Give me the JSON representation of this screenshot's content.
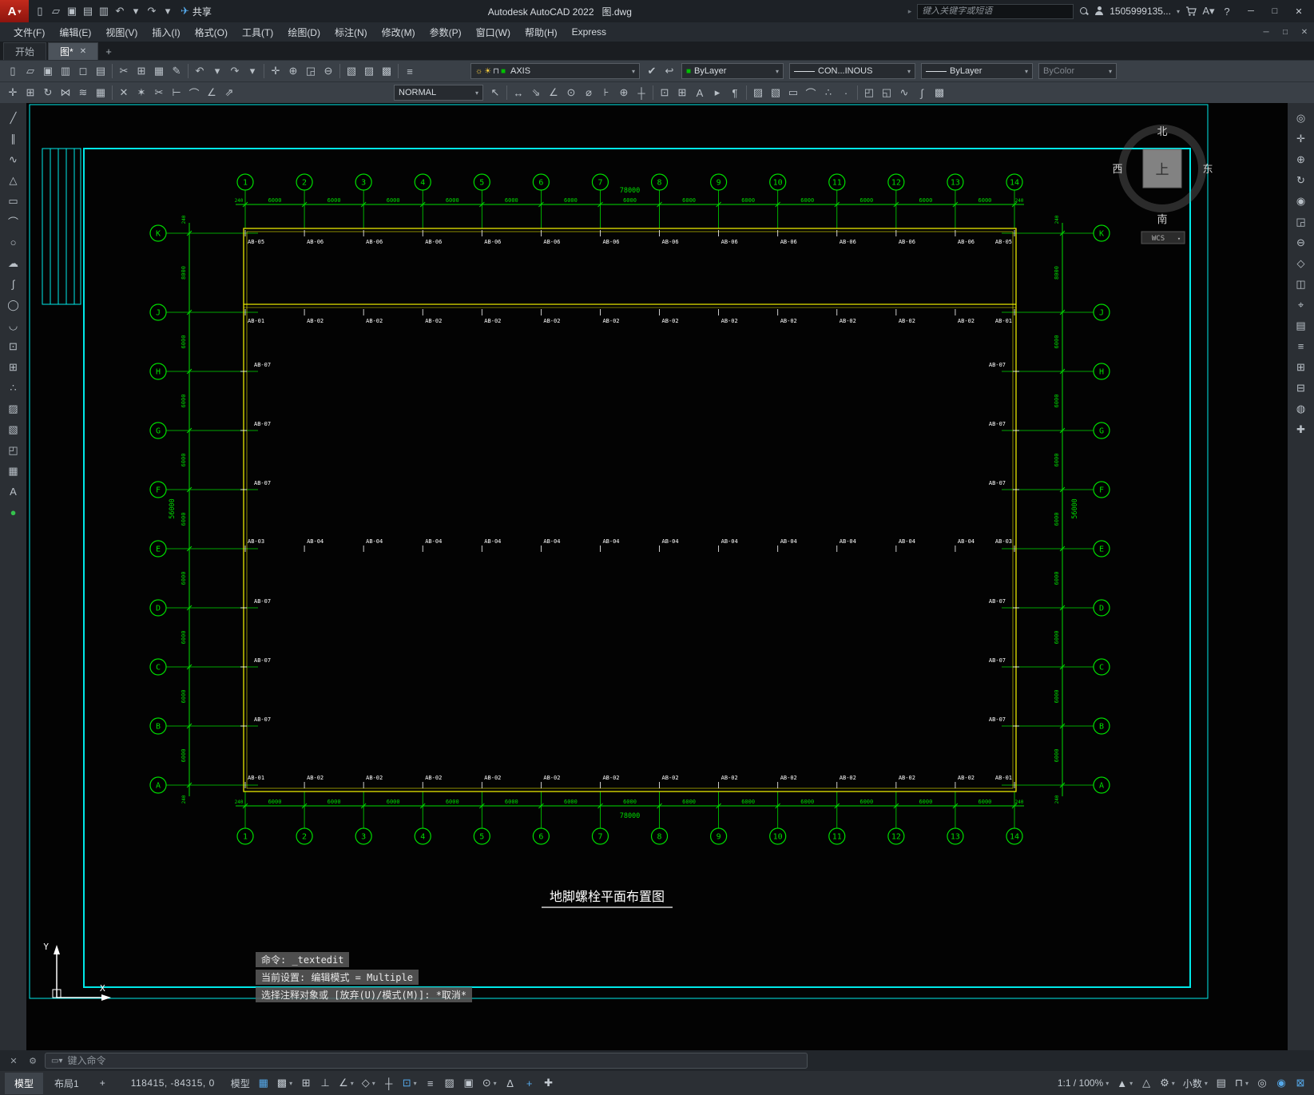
{
  "titlebar": {
    "logo": "A",
    "qat_icons": [
      {
        "n": "new-file",
        "g": "▯"
      },
      {
        "n": "open-file",
        "g": "▱"
      },
      {
        "n": "save",
        "g": "▣"
      },
      {
        "n": "save-as",
        "g": "▤"
      },
      {
        "n": "plot",
        "g": "▥"
      },
      {
        "n": "undo",
        "g": "↶"
      },
      {
        "n": "undo-list",
        "g": "▾"
      },
      {
        "n": "redo",
        "g": "↷"
      },
      {
        "n": "redo-list",
        "g": "▾"
      }
    ],
    "share_label": "共享",
    "app_title": "Autodesk AutoCAD 2022",
    "doc_title": "图.dwg",
    "search_placeholder": "键入关键字或短语",
    "user_name": "1505999135...",
    "window_controls": {
      "min": "─",
      "max": "□",
      "close": "✕"
    }
  },
  "menubar": {
    "items": [
      {
        "label": "文件(F)"
      },
      {
        "label": "编辑(E)"
      },
      {
        "label": "视图(V)"
      },
      {
        "label": "插入(I)"
      },
      {
        "label": "格式(O)"
      },
      {
        "label": "工具(T)"
      },
      {
        "label": "绘图(D)"
      },
      {
        "label": "标注(N)"
      },
      {
        "label": "修改(M)"
      },
      {
        "label": "参数(P)"
      },
      {
        "label": "窗口(W)"
      },
      {
        "label": "帮助(H)"
      },
      {
        "label": "Express"
      }
    ],
    "window_controls": {
      "min": "─",
      "restore": "□",
      "close": "✕"
    }
  },
  "filetabs": {
    "tabs": [
      {
        "label": "开始",
        "active": false
      },
      {
        "label": "图*",
        "active": true,
        "close": "✕"
      }
    ],
    "new_tab": "+"
  },
  "toolbar1": {
    "icons": [
      {
        "n": "qnew",
        "g": "▯"
      },
      {
        "n": "open",
        "g": "▱"
      },
      {
        "n": "qsave",
        "g": "▣"
      },
      {
        "n": "plot",
        "g": "▥"
      },
      {
        "n": "plot-preview",
        "g": "◻"
      },
      {
        "n": "publish",
        "g": "▤"
      },
      {
        "sep": 1
      },
      {
        "n": "cut",
        "g": "✂"
      },
      {
        "n": "copy-clip",
        "g": "⊞"
      },
      {
        "n": "paste",
        "g": "▦"
      },
      {
        "n": "match-properties",
        "g": "✎"
      },
      {
        "sep": 1
      },
      {
        "n": "undo",
        "g": "↶"
      },
      {
        "n": "undo-list",
        "g": "▾"
      },
      {
        "n": "redo",
        "g": "↷"
      },
      {
        "n": "redo-list",
        "g": "▾"
      },
      {
        "sep": 1
      },
      {
        "n": "pan",
        "g": "✛"
      },
      {
        "n": "zoom-realtime",
        "g": "⊕"
      },
      {
        "n": "zoom-window",
        "g": "◲"
      },
      {
        "n": "zoom-previous",
        "g": "⊖"
      },
      {
        "sep": 1
      },
      {
        "n": "properties-palette",
        "g": "▧"
      },
      {
        "n": "designcenter",
        "g": "▨"
      },
      {
        "n": "tool-palettes",
        "g": "▩"
      },
      {
        "sep": 1
      },
      {
        "n": "layer-properties",
        "g": "≡"
      }
    ],
    "layer_state_icons": [
      {
        "n": "layer-on",
        "g": "☼",
        "c": "#ffd23e"
      },
      {
        "n": "layer-thaw",
        "g": "☀",
        "c": "#ffd23e"
      },
      {
        "n": "layer-lock",
        "g": "⊓",
        "c": "#c8cdd4"
      },
      {
        "n": "layer-color-swatch",
        "g": "■",
        "c": "#00c000"
      }
    ],
    "layer_combo": {
      "value": "AXIS"
    },
    "post_icons": [
      {
        "n": "make-object-layer-current",
        "g": "✔"
      },
      {
        "n": "layer-previous",
        "g": "↩"
      }
    ],
    "color_combo": "ByLayer",
    "linetype_combo": "CON...INOUS",
    "lineweight_combo": "ByLayer",
    "plotstyle_combo": "ByColor"
  },
  "toolbar2": {
    "icons_a": [
      {
        "n": "move",
        "g": "✛"
      },
      {
        "n": "copy-object",
        "g": "⊞"
      },
      {
        "n": "rotate",
        "g": "↻"
      },
      {
        "n": "mirror",
        "g": "⋈"
      },
      {
        "n": "offset",
        "g": "≋"
      },
      {
        "n": "array",
        "g": "▦"
      },
      {
        "sep": 1
      },
      {
        "n": "erase",
        "g": "✕"
      },
      {
        "n": "explode",
        "g": "✶"
      },
      {
        "n": "trim",
        "g": "✂"
      },
      {
        "n": "extend",
        "g": "⊢"
      },
      {
        "n": "fillet",
        "g": "⌒"
      },
      {
        "n": "chamfer",
        "g": "∠"
      },
      {
        "n": "scale",
        "g": "⇗"
      }
    ],
    "style_combo": "NORMAL",
    "icons_b": [
      {
        "n": "multileader",
        "g": "↖"
      },
      {
        "sep": 1
      },
      {
        "n": "dim-linear",
        "g": "↔"
      },
      {
        "n": "dim-aligned",
        "g": "⇘"
      },
      {
        "n": "dim-angular",
        "g": "∠"
      },
      {
        "n": "dim-radius",
        "g": "⊙"
      },
      {
        "n": "dim-diameter",
        "g": "⌀"
      },
      {
        "n": "dim-continue",
        "g": "⊦"
      },
      {
        "n": "tolerance",
        "g": "⊕"
      },
      {
        "n": "center-mark",
        "g": "┼"
      },
      {
        "sep": 1
      },
      {
        "n": "insert-block",
        "g": "⊡"
      },
      {
        "n": "make-block",
        "g": "⊞"
      },
      {
        "n": "text-style",
        "g": "A"
      },
      {
        "n": "single-text",
        "g": "▸"
      },
      {
        "n": "mtext",
        "g": "¶"
      },
      {
        "sep": 1
      },
      {
        "n": "hatch",
        "g": "▨"
      },
      {
        "n": "gradient",
        "g": "▧"
      },
      {
        "n": "boundary",
        "g": "▭"
      },
      {
        "n": "measure",
        "g": "⌒"
      },
      {
        "n": "divide",
        "g": "∴"
      },
      {
        "n": "point-style",
        "g": "·"
      },
      {
        "sep": 1
      },
      {
        "n": "group",
        "g": "◰"
      },
      {
        "n": "ungroup",
        "g": "◱"
      },
      {
        "n": "edit-polyline",
        "g": "∿"
      },
      {
        "n": "edit-spline",
        "g": "∫"
      },
      {
        "n": "edit-hatch",
        "g": "▩"
      }
    ]
  },
  "left_palette": {
    "icons": [
      {
        "n": "line",
        "g": "╱"
      },
      {
        "n": "construction-line",
        "g": "∥"
      },
      {
        "n": "polyline",
        "g": "∿"
      },
      {
        "n": "polygon",
        "g": "△"
      },
      {
        "n": "rectangle",
        "g": "▭"
      },
      {
        "n": "arc",
        "g": "⌒"
      },
      {
        "n": "circle",
        "g": "○"
      },
      {
        "n": "revision-cloud",
        "g": "☁"
      },
      {
        "n": "spline",
        "g": "∫"
      },
      {
        "n": "ellipse",
        "g": "◯"
      },
      {
        "n": "ellipse-arc",
        "g": "◡"
      },
      {
        "n": "insert-block",
        "g": "⊡"
      },
      {
        "n": "create-block",
        "g": "⊞"
      },
      {
        "n": "point",
        "g": "∴"
      },
      {
        "n": "hatch",
        "g": "▨"
      },
      {
        "n": "gradient",
        "g": "▧"
      },
      {
        "n": "region",
        "g": "◰"
      },
      {
        "n": "table",
        "g": "▦"
      },
      {
        "n": "multiline-text",
        "g": "A"
      },
      {
        "n": "point-style",
        "g": "●",
        "c": "#35c24d"
      }
    ]
  },
  "right_palette": {
    "icons": [
      {
        "n": "navigation-wheel",
        "g": "◎"
      },
      {
        "n": "pan",
        "g": "✛"
      },
      {
        "n": "zoom-extents",
        "g": "⊕"
      },
      {
        "n": "orbit",
        "g": "↻"
      },
      {
        "n": "show-motion",
        "g": "◉"
      },
      {
        "n": "zoom-window",
        "g": "◲"
      },
      {
        "n": "zoom-previous",
        "g": "⊖"
      },
      {
        "n": "viewcube-settings",
        "g": "◇"
      },
      {
        "n": "section-plane",
        "g": "◫"
      },
      {
        "n": "measure-distance",
        "g": "⌖"
      },
      {
        "n": "layer-walk",
        "g": "▤"
      },
      {
        "n": "view-list",
        "g": "≡"
      },
      {
        "n": "add-view",
        "g": "⊞"
      },
      {
        "n": "remove-view",
        "g": "⊟"
      },
      {
        "n": "materials",
        "g": "◍"
      },
      {
        "n": "render",
        "g": "✚"
      }
    ]
  },
  "drawing": {
    "title": "地脚螺栓平面布置图",
    "columns": [
      "1",
      "2",
      "3",
      "4",
      "5",
      "6",
      "7",
      "8",
      "9",
      "10",
      "11",
      "12",
      "13",
      "14"
    ],
    "rows": [
      "K",
      "J",
      "H",
      "G",
      "F",
      "E",
      "D",
      "C",
      "B",
      "A"
    ],
    "bay_width": "6000",
    "total_width": "78000",
    "end_offset": "240",
    "row_bays": [
      "8000",
      "6000",
      "6000",
      "6000",
      "6000",
      "6000",
      "6000",
      "6000",
      "6000"
    ],
    "total_height": "56000",
    "bolt_rows": [
      {
        "row": "K",
        "end": "AB-05",
        "mid": "AB-06",
        "label_side": "below"
      },
      {
        "row": "J",
        "end": "AB-01",
        "mid": "AB-02",
        "label_side": "below"
      },
      {
        "row": "E",
        "end": "AB-03",
        "mid": "AB-04",
        "label_side": "above"
      },
      {
        "row": "A",
        "end": "AB-01",
        "mid": "AB-02",
        "label_side": "above"
      }
    ],
    "edge_rows": {
      "rows": [
        "H",
        "G",
        "F",
        "D",
        "C",
        "B"
      ],
      "label": "AB-07"
    },
    "viewcube": {
      "north": "北",
      "south": "南",
      "west": "西",
      "east": "东",
      "up": "上",
      "wcs": "WCS"
    },
    "ucs": {
      "x": "X",
      "y": "Y"
    }
  },
  "command": {
    "history": [
      "命令: _textedit",
      "当前设置: 编辑模式 = Multiple",
      "选择注释对象或 [放弃(U)/模式(M)]: *取消*"
    ],
    "placeholder": "键入命令"
  },
  "statusbar": {
    "layout_tabs": [
      {
        "label": "模型",
        "active": true
      },
      {
        "label": "布局1",
        "active": false
      },
      {
        "label": "+",
        "active": false
      }
    ],
    "coords": "118415, -84315, 0",
    "toggles": [
      {
        "n": "model-paper-toggle",
        "t": "模型"
      },
      {
        "n": "grid-display",
        "g": "▦",
        "on": true
      },
      {
        "n": "snap-mode",
        "g": "▩",
        "caret": true
      },
      {
        "n": "infer-constraints",
        "g": "⊞"
      },
      {
        "n": "ortho-mode",
        "g": "⊥"
      },
      {
        "n": "polar-tracking",
        "g": "∠",
        "caret": true
      },
      {
        "n": "isometric-drafting",
        "g": "◇",
        "caret": true
      },
      {
        "n": "object-snap-tracking",
        "g": "┼"
      },
      {
        "n": "object-snap",
        "g": "⊡",
        "on": true,
        "caret": true
      },
      {
        "n": "lineweight-display",
        "g": "≡"
      },
      {
        "n": "transparency",
        "g": "▨"
      },
      {
        "n": "selection-cycling",
        "g": "▣"
      },
      {
        "n": "3d-object-snap",
        "g": "⊙",
        "caret": true
      },
      {
        "n": "dynamic-ucs",
        "g": "∆"
      },
      {
        "n": "dynamic-input",
        "g": "+",
        "on": true
      },
      {
        "n": "annotation-monitor",
        "g": "✚"
      }
    ],
    "right_items": [
      {
        "n": "annotation-scale",
        "t": "1:1 / 100%",
        "caret": true
      },
      {
        "n": "annotation-visibility",
        "g": "▲",
        "caret": true
      },
      {
        "n": "annotation-autoscale",
        "g": "△"
      },
      {
        "n": "workspace-switching",
        "g": "⚙",
        "caret": true
      },
      {
        "n": "units",
        "t": "小数",
        "caret": true
      },
      {
        "n": "quick-properties",
        "g": "▤"
      },
      {
        "n": "lock-ui",
        "g": "⊓",
        "caret": true
      },
      {
        "n": "isolate-objects",
        "g": "◎"
      },
      {
        "n": "graphics-performance",
        "g": "◉",
        "on": true
      },
      {
        "n": "clean-screen",
        "g": "⊠",
        "on": true
      }
    ]
  }
}
